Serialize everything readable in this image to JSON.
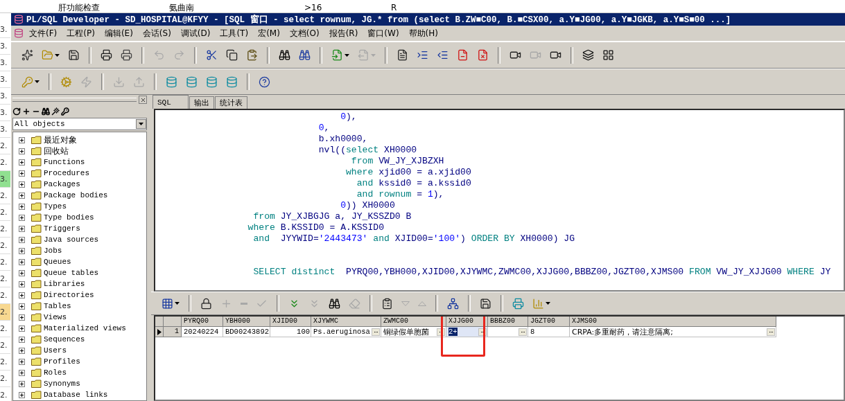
{
  "background": {
    "top_cells": [
      "肝功能检查",
      "氨曲南",
      ">16",
      "R"
    ],
    "side_cells": [
      {
        "text": "3."
      },
      {
        "text": "3."
      },
      {
        "text": "3."
      },
      {
        "text": "3."
      },
      {
        "text": "3."
      },
      {
        "text": "3."
      },
      {
        "text": "3."
      },
      {
        "text": "2."
      },
      {
        "text": "2."
      },
      {
        "text": "3.",
        "color": "#90e090"
      },
      {
        "text": "2."
      },
      {
        "text": "2."
      },
      {
        "text": "2."
      },
      {
        "text": "2."
      },
      {
        "text": "2."
      },
      {
        "text": "2."
      },
      {
        "text": "2."
      },
      {
        "text": "2.",
        "color": "#f8d890"
      },
      {
        "text": "2."
      },
      {
        "text": "2."
      },
      {
        "text": "2."
      },
      {
        "text": "2."
      },
      {
        "text": "2."
      }
    ]
  },
  "window": {
    "title": "PL/SQL Developer - SD_HOSPITAL@KFYY - [SQL 窗口 - select rownum, JG.* from (select B.ZW■C00, B.■CSX00, a.Y■JG00, a.Y■JGKB, a.Y■S■00 ...]"
  },
  "menu": [
    "文件(F)",
    "工程(P)",
    "编辑(E)",
    "会话(S)",
    "调试(D)",
    "工具(T)",
    "宏(M)",
    "文档(O)",
    "报告(R)",
    "窗口(W)",
    "帮助(H)"
  ],
  "toolbar_1": [
    [
      {
        "disabled": false,
        "dropdown": false
      },
      {
        "disabled": false,
        "dropdown": true
      },
      {
        "disabled": false,
        "dropdown": false
      }
    ],
    [
      {
        "disabled": false,
        "dropdown": false
      },
      {
        "disabled": false,
        "dropdown": false
      }
    ],
    [
      {
        "disabled": true,
        "dropdown": false
      },
      {
        "disabled": true,
        "dropdown": false
      }
    ],
    [
      {
        "disabled": false,
        "dropdown": false
      },
      {
        "disabled": false,
        "dropdown": false
      },
      {
        "disabled": false,
        "dropdown": false
      }
    ],
    [
      {
        "disabled": false,
        "dropdown": false
      },
      {
        "disabled": false,
        "dropdown": false
      }
    ],
    [
      {
        "disabled": false,
        "dropdown": true
      },
      {
        "disabled": true,
        "dropdown": true
      }
    ],
    [
      {
        "disabled": false,
        "dropdown": false
      },
      {
        "disabled": false,
        "dropdown": false
      },
      {
        "disabled": false,
        "dropdown": false
      },
      {
        "disabled": false,
        "dropdown": false
      },
      {
        "disabled": false,
        "dropdown": false
      }
    ],
    [
      {
        "disabled": false,
        "dropdown": false
      },
      {
        "disabled": true,
        "dropdown": false
      },
      {
        "disabled": false,
        "dropdown": false
      }
    ],
    [
      {
        "disabled": false,
        "dropdown": false
      },
      {
        "disabled": false,
        "dropdown": false
      }
    ]
  ],
  "toolbar_2": [
    [
      {
        "disabled": false,
        "dropdown": true
      }
    ],
    [
      {
        "disabled": false,
        "dropdown": false
      },
      {
        "disabled": true,
        "dropdown": false
      }
    ],
    [
      {
        "disabled": true,
        "dropdown": false
      },
      {
        "disabled": true,
        "dropdown": false
      }
    ],
    [
      {
        "disabled": false,
        "dropdown": false
      },
      {
        "disabled": false,
        "dropdown": false
      },
      {
        "disabled": false,
        "dropdown": false
      },
      {
        "disabled": false,
        "dropdown": false
      }
    ],
    [
      {
        "disabled": false,
        "dropdown": false
      }
    ]
  ],
  "object_browser": {
    "filter": "All objects",
    "items": [
      "最近对象",
      "回收站",
      "Functions",
      "Procedures",
      "Packages",
      "Package bodies",
      "Types",
      "Type bodies",
      "Triggers",
      "Java sources",
      "Jobs",
      "Queues",
      "Queue tables",
      "Libraries",
      "Directories",
      "Tables",
      "Views",
      "Materialized views",
      "Sequences",
      "Users",
      "Profiles",
      "Roles",
      "Synonyms",
      "Database links"
    ]
  },
  "tabs": [
    {
      "label": "SQL",
      "selected": true
    },
    {
      "label": "输出",
      "selected": false
    },
    {
      "label": "统计表",
      "selected": false
    }
  ],
  "editor_blocks": [
    [
      [
        {
          "kind": "num",
          "text": "                                  0"
        },
        {
          "kind": "id",
          "text": "),"
        }
      ],
      [
        {
          "kind": "num",
          "text": "                              0"
        },
        {
          "kind": "id",
          "text": ","
        }
      ],
      [
        {
          "kind": "id",
          "text": "                              b.xh0000,"
        }
      ],
      [
        {
          "kind": "id",
          "text": "                              nvl(("
        },
        {
          "kind": "kw",
          "text": "select"
        },
        {
          "kind": "id",
          "text": " XH0000"
        }
      ],
      [
        {
          "kind": "kw",
          "text": "                                    from"
        },
        {
          "kind": "id",
          "text": " VW_JY_XJBZXH"
        }
      ],
      [
        {
          "kind": "kw",
          "text": "                                   where"
        },
        {
          "kind": "id",
          "text": " xjid00 = a.xjid00"
        }
      ],
      [
        {
          "kind": "kw",
          "text": "                                     and"
        },
        {
          "kind": "id",
          "text": " kssid0 = a.kssid0"
        }
      ],
      [
        {
          "kind": "kw",
          "text": "                                     and rownum"
        },
        {
          "kind": "id",
          "text": " = "
        },
        {
          "kind": "num",
          "text": "1"
        },
        {
          "kind": "id",
          "text": "),"
        }
      ],
      [
        {
          "kind": "num",
          "text": "                                  0"
        },
        {
          "kind": "id",
          "text": ")) XH0000"
        }
      ],
      [
        {
          "kind": "kw",
          "text": "                  from"
        },
        {
          "kind": "id",
          "text": " JY_XJBGJG a, JY_KSSZD0 B"
        }
      ],
      [
        {
          "kind": "kw",
          "text": "                 where"
        },
        {
          "kind": "id",
          "text": " B.KSSID0 = A.KSSID0"
        }
      ],
      [
        {
          "kind": "kw",
          "text": "                  and"
        },
        {
          "kind": "id",
          "text": "  JYYWID="
        },
        {
          "kind": "num",
          "text": "'2443473'"
        },
        {
          "kind": "kw",
          "text": " and"
        },
        {
          "kind": "id",
          "text": " XJID00="
        },
        {
          "kind": "num",
          "text": "'100'"
        },
        {
          "kind": "id",
          "text": ") "
        },
        {
          "kind": "kw",
          "text": "ORDER BY"
        },
        {
          "kind": "id",
          "text": " XH0000) JG"
        }
      ]
    ],
    [
      [
        {
          "kind": "kw",
          "text": "                  SELECT distinct"
        },
        {
          "kind": "id",
          "text": "  PYRQ00,YBH000,XJID00,XJYWMC,ZWMC00,XJJG00,BBBZ00,JGZT00,XJMS00 "
        },
        {
          "kind": "kw",
          "text": "FROM"
        },
        {
          "kind": "id",
          "text": " VW_JY_XJJG00 "
        },
        {
          "kind": "kw",
          "text": "WHERE"
        },
        {
          "kind": "id",
          "text": " JY"
        }
      ]
    ]
  ],
  "result_toolbar": [
    [
      {
        "disabled": false,
        "dropdown": true
      }
    ],
    [
      {
        "disabled": false,
        "dropdown": false
      },
      {
        "disabled": true,
        "dropdown": false
      },
      {
        "disabled": true,
        "dropdown": false
      },
      {
        "disabled": true,
        "dropdown": false
      }
    ],
    [
      {
        "disabled": false,
        "dropdown": false
      },
      {
        "disabled": true,
        "dropdown": false
      },
      {
        "disabled": false,
        "dropdown": false
      },
      {
        "disabled": true,
        "dropdown": false
      }
    ],
    [
      {
        "disabled": false,
        "dropdown": false
      },
      {
        "disabled": true,
        "dropdown": false
      },
      {
        "disabled": true,
        "dropdown": false
      }
    ],
    [
      {
        "disabled": false,
        "dropdown": false
      }
    ],
    [
      {
        "disabled": false,
        "dropdown": false
      }
    ],
    [
      {
        "disabled": false,
        "dropdown": false
      },
      {
        "disabled": false,
        "dropdown": true
      }
    ]
  ],
  "grid": {
    "columns": [
      {
        "name": "PYRQ00",
        "circled": false
      },
      {
        "name": "YBH000",
        "circled": false
      },
      {
        "name": "XJID00",
        "circled": false
      },
      {
        "name": "XJYWMC",
        "circled": false
      },
      {
        "name": "ZWMC00",
        "circled": false
      },
      {
        "name": "XJJG00",
        "circled": true
      },
      {
        "name": "BBBZ00",
        "circled": false
      },
      {
        "name": "JGZT00",
        "circled": false
      },
      {
        "name": "XJMS00",
        "circled": false
      }
    ],
    "rows": [
      {
        "number": "1",
        "selected": true,
        "cells": [
          {
            "kind": "text",
            "text": "20240224",
            "button": false,
            "selected": false
          },
          {
            "kind": "text",
            "text": "BD00243892",
            "button": false,
            "selected": false
          },
          {
            "kind": "number",
            "text": "100",
            "button": false,
            "selected": false
          },
          {
            "kind": "text",
            "text": "Ps.aeruginosa",
            "button": true,
            "selected": false
          },
          {
            "kind": "text",
            "text": "铜绿假单胞菌",
            "button": true,
            "selected": false
          },
          {
            "kind": "text",
            "text": "2+",
            "button": true,
            "selected": true
          },
          {
            "kind": "text",
            "button": true,
            "selected": false
          },
          {
            "kind": "text",
            "text": "8",
            "button": false,
            "selected": false
          },
          {
            "kind": "text",
            "text": "CRPA:多重耐药，请注意隔离;",
            "button": true,
            "selected": false
          }
        ]
      }
    ]
  }
}
